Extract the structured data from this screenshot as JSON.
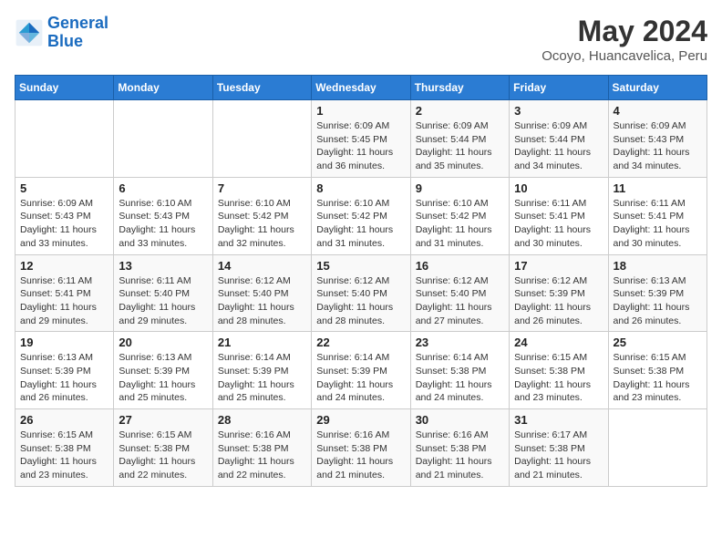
{
  "header": {
    "logo_line1": "General",
    "logo_line2": "Blue",
    "month_year": "May 2024",
    "location": "Ocoyo, Huancavelica, Peru"
  },
  "weekdays": [
    "Sunday",
    "Monday",
    "Tuesday",
    "Wednesday",
    "Thursday",
    "Friday",
    "Saturday"
  ],
  "weeks": [
    [
      {
        "day": "",
        "info": ""
      },
      {
        "day": "",
        "info": ""
      },
      {
        "day": "",
        "info": ""
      },
      {
        "day": "1",
        "info": "Sunrise: 6:09 AM\nSunset: 5:45 PM\nDaylight: 11 hours and 36 minutes."
      },
      {
        "day": "2",
        "info": "Sunrise: 6:09 AM\nSunset: 5:44 PM\nDaylight: 11 hours and 35 minutes."
      },
      {
        "day": "3",
        "info": "Sunrise: 6:09 AM\nSunset: 5:44 PM\nDaylight: 11 hours and 34 minutes."
      },
      {
        "day": "4",
        "info": "Sunrise: 6:09 AM\nSunset: 5:43 PM\nDaylight: 11 hours and 34 minutes."
      }
    ],
    [
      {
        "day": "5",
        "info": "Sunrise: 6:09 AM\nSunset: 5:43 PM\nDaylight: 11 hours and 33 minutes."
      },
      {
        "day": "6",
        "info": "Sunrise: 6:10 AM\nSunset: 5:43 PM\nDaylight: 11 hours and 33 minutes."
      },
      {
        "day": "7",
        "info": "Sunrise: 6:10 AM\nSunset: 5:42 PM\nDaylight: 11 hours and 32 minutes."
      },
      {
        "day": "8",
        "info": "Sunrise: 6:10 AM\nSunset: 5:42 PM\nDaylight: 11 hours and 31 minutes."
      },
      {
        "day": "9",
        "info": "Sunrise: 6:10 AM\nSunset: 5:42 PM\nDaylight: 11 hours and 31 minutes."
      },
      {
        "day": "10",
        "info": "Sunrise: 6:11 AM\nSunset: 5:41 PM\nDaylight: 11 hours and 30 minutes."
      },
      {
        "day": "11",
        "info": "Sunrise: 6:11 AM\nSunset: 5:41 PM\nDaylight: 11 hours and 30 minutes."
      }
    ],
    [
      {
        "day": "12",
        "info": "Sunrise: 6:11 AM\nSunset: 5:41 PM\nDaylight: 11 hours and 29 minutes."
      },
      {
        "day": "13",
        "info": "Sunrise: 6:11 AM\nSunset: 5:40 PM\nDaylight: 11 hours and 29 minutes."
      },
      {
        "day": "14",
        "info": "Sunrise: 6:12 AM\nSunset: 5:40 PM\nDaylight: 11 hours and 28 minutes."
      },
      {
        "day": "15",
        "info": "Sunrise: 6:12 AM\nSunset: 5:40 PM\nDaylight: 11 hours and 28 minutes."
      },
      {
        "day": "16",
        "info": "Sunrise: 6:12 AM\nSunset: 5:40 PM\nDaylight: 11 hours and 27 minutes."
      },
      {
        "day": "17",
        "info": "Sunrise: 6:12 AM\nSunset: 5:39 PM\nDaylight: 11 hours and 26 minutes."
      },
      {
        "day": "18",
        "info": "Sunrise: 6:13 AM\nSunset: 5:39 PM\nDaylight: 11 hours and 26 minutes."
      }
    ],
    [
      {
        "day": "19",
        "info": "Sunrise: 6:13 AM\nSunset: 5:39 PM\nDaylight: 11 hours and 26 minutes."
      },
      {
        "day": "20",
        "info": "Sunrise: 6:13 AM\nSunset: 5:39 PM\nDaylight: 11 hours and 25 minutes."
      },
      {
        "day": "21",
        "info": "Sunrise: 6:14 AM\nSunset: 5:39 PM\nDaylight: 11 hours and 25 minutes."
      },
      {
        "day": "22",
        "info": "Sunrise: 6:14 AM\nSunset: 5:39 PM\nDaylight: 11 hours and 24 minutes."
      },
      {
        "day": "23",
        "info": "Sunrise: 6:14 AM\nSunset: 5:38 PM\nDaylight: 11 hours and 24 minutes."
      },
      {
        "day": "24",
        "info": "Sunrise: 6:15 AM\nSunset: 5:38 PM\nDaylight: 11 hours and 23 minutes."
      },
      {
        "day": "25",
        "info": "Sunrise: 6:15 AM\nSunset: 5:38 PM\nDaylight: 11 hours and 23 minutes."
      }
    ],
    [
      {
        "day": "26",
        "info": "Sunrise: 6:15 AM\nSunset: 5:38 PM\nDaylight: 11 hours and 23 minutes."
      },
      {
        "day": "27",
        "info": "Sunrise: 6:15 AM\nSunset: 5:38 PM\nDaylight: 11 hours and 22 minutes."
      },
      {
        "day": "28",
        "info": "Sunrise: 6:16 AM\nSunset: 5:38 PM\nDaylight: 11 hours and 22 minutes."
      },
      {
        "day": "29",
        "info": "Sunrise: 6:16 AM\nSunset: 5:38 PM\nDaylight: 11 hours and 21 minutes."
      },
      {
        "day": "30",
        "info": "Sunrise: 6:16 AM\nSunset: 5:38 PM\nDaylight: 11 hours and 21 minutes."
      },
      {
        "day": "31",
        "info": "Sunrise: 6:17 AM\nSunset: 5:38 PM\nDaylight: 11 hours and 21 minutes."
      },
      {
        "day": "",
        "info": ""
      }
    ]
  ]
}
